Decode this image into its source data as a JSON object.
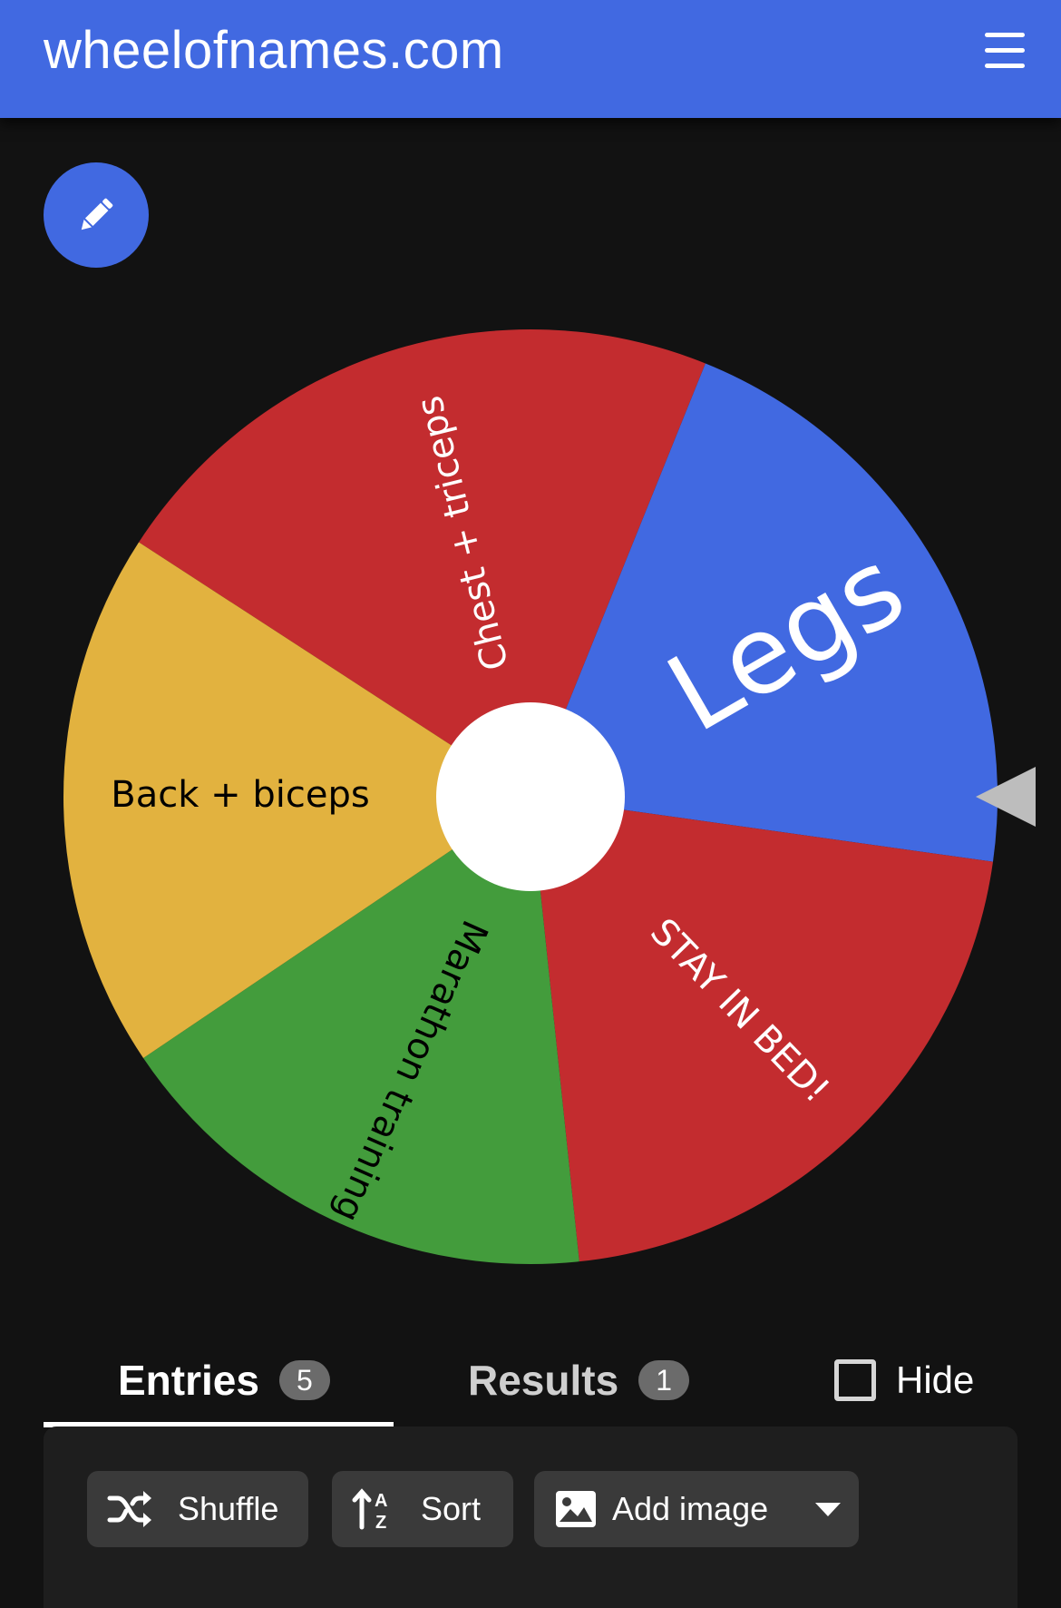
{
  "header": {
    "title": "wheelofnames.com",
    "menu_icon": "hamburger-menu-icon"
  },
  "edit_button": {
    "icon": "pencil-icon"
  },
  "wheel": {
    "segments": [
      {
        "label": "Chest + triceps",
        "color": "#c32c2f",
        "text_color": "#ffffff"
      },
      {
        "label": "Legs",
        "color": "#4169e1",
        "text_color": "#ffffff"
      },
      {
        "label": "STAY IN BED!",
        "color": "#c32c2f",
        "text_color": "#ffffff"
      },
      {
        "label": "Marathon training",
        "color": "#439c3c",
        "text_color": "#000000"
      },
      {
        "label": "Back + biceps",
        "color": "#e2b23f",
        "text_color": "#000000"
      }
    ],
    "winner": "Legs",
    "pointer_icon": "pointer-triangle-icon"
  },
  "tabs": {
    "entries": {
      "label": "Entries",
      "count": "5"
    },
    "results": {
      "label": "Results",
      "count": "1"
    },
    "hide_label": "Hide",
    "hide_checked": false
  },
  "toolbar": {
    "shuffle_label": "Shuffle",
    "sort_label": "Sort",
    "add_image_label": "Add image",
    "shuffle_icon": "shuffle-icon",
    "sort_icon": "sort-az-icon",
    "image_icon": "image-icon",
    "dropdown_icon": "caret-down-icon"
  }
}
